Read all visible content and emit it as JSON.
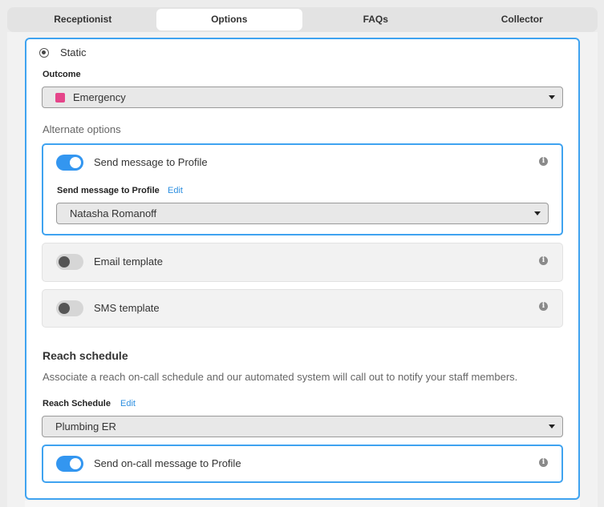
{
  "tabs": [
    {
      "label": "Receptionist",
      "active": false
    },
    {
      "label": "Options",
      "active": true
    },
    {
      "label": "FAQs",
      "active": false
    },
    {
      "label": "Collector",
      "active": false
    }
  ],
  "mode": {
    "label": "Static",
    "selected": true
  },
  "outcome": {
    "label": "Outcome",
    "value": "Emergency",
    "swatch_color": "#e5458a"
  },
  "alternate": {
    "heading": "Alternate options",
    "send_message": {
      "label": "Send message to Profile",
      "enabled": true,
      "field_label": "Send message to Profile",
      "edit_label": "Edit",
      "value": "Natasha Romanoff"
    },
    "email_template": {
      "label": "Email template",
      "enabled": false
    },
    "sms_template": {
      "label": "SMS template",
      "enabled": false
    }
  },
  "reach": {
    "title": "Reach schedule",
    "description": "Associate a reach on-call schedule and our automated system will call out to notify your staff members.",
    "field_label": "Reach Schedule",
    "edit_label": "Edit",
    "value": "Plumbing ER",
    "oncall": {
      "label": "Send on-call message to Profile",
      "enabled": true
    }
  },
  "icons": {
    "info": "i",
    "accent": "#3fa3f0",
    "toggle_on": "#3396f0"
  }
}
